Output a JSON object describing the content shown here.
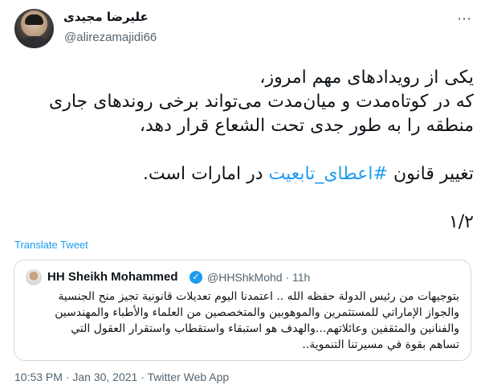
{
  "tweet": {
    "author_name": "علیرضا مجیدی",
    "author_handle": "@alirezamajidi66",
    "lines": [
      "یکی از رویدادهای مهم امروز،",
      "که در کوتاه‌مدت و میان‌مدت می‌تواند برخی روندهای جاری",
      "منطقه را به طور جدی تحت الشعاع قرار دهد،"
    ],
    "line4_before": "تغییر قانون ",
    "hashtag": "#اعطای_تابعیت",
    "line4_after": " در امارات است.",
    "thread_counter": "۱/۲",
    "translate_label": "Translate Tweet",
    "footer": "10:53 PM · Jan 30, 2021 · Twitter Web App"
  },
  "quote": {
    "name": "HH Sheikh Mohammed",
    "verified_mark": "✓",
    "meta": "@HHShkMohd · 11h",
    "lines": [
      "بتوجيهات من رئيس الدولة حفظه الله .. اعتمدنا اليوم تعديلات قانونية تجيز منح الجنسية",
      "والجواز الإماراتي للمستثمرين والموهوبين والمتخصصين من العلماء والأطباء والمهندسين",
      "والفنانين والمثقفين وعائلاتهم...والهدف هو استبقاء واستقطاب واستقرار العقول التي",
      "تساهم بقوة في مسيرتنا التنموية.."
    ]
  },
  "icons": {
    "more": "more-options-icon",
    "verified": "verified-badge-icon"
  },
  "colors": {
    "link": "#1d9bf0",
    "secondary_text": "#536471",
    "border": "#cfd9de"
  }
}
